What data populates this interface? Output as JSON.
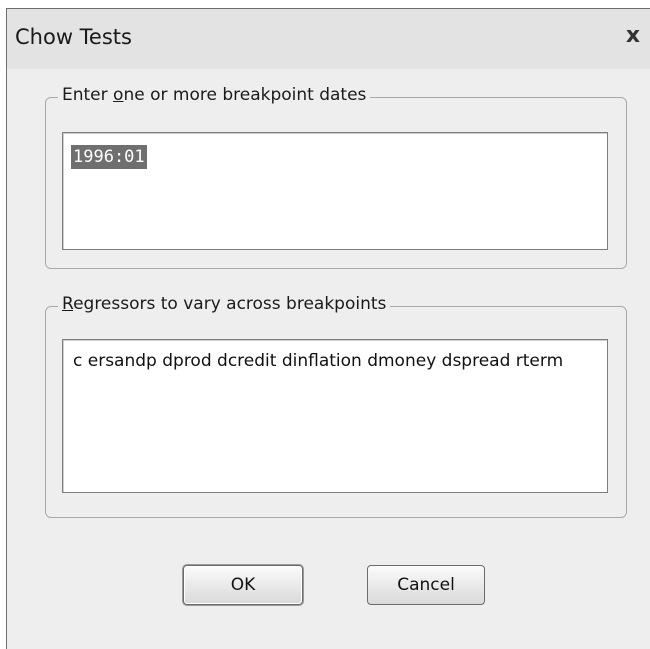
{
  "dialog": {
    "title": "Chow Tests",
    "close_glyph": "x"
  },
  "breakpoints": {
    "legend_prefix": "Enter ",
    "legend_accel": "o",
    "legend_suffix": "ne or more breakpoint dates",
    "value": "1996:01"
  },
  "regressors": {
    "legend_accel": "R",
    "legend_suffix": "egressors to vary across breakpoints",
    "value": "c ersandp dprod dcredit dinflation dmoney dspread rterm"
  },
  "buttons": {
    "ok": "OK",
    "cancel": "Cancel"
  }
}
